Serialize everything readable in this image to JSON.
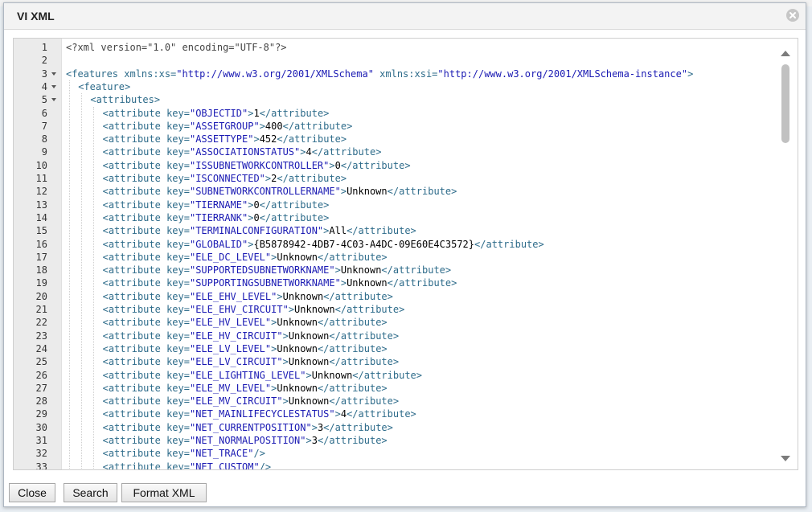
{
  "dialog": {
    "title": "VI XML"
  },
  "buttons": {
    "close": "Close",
    "search": "Search",
    "format_xml": "Format XML"
  },
  "editor": {
    "fold_lines": [
      3,
      4,
      5
    ],
    "lines": [
      {
        "n": "1",
        "indent": 0,
        "parts": [
          [
            "decl",
            "<?xml version=\"1.0\" encoding=\"UTF-8\"?>"
          ]
        ]
      },
      {
        "n": "2",
        "indent": 0,
        "parts": []
      },
      {
        "n": "3",
        "indent": 0,
        "parts": [
          [
            "tag",
            "<features "
          ],
          [
            "attr",
            "xmlns:xs="
          ],
          [
            "str",
            "\"http://www.w3.org/2001/XMLSchema\""
          ],
          [
            "attr",
            " xmlns:xsi="
          ],
          [
            "str",
            "\"http://www.w3.org/2001/XMLSchema-instance\""
          ],
          [
            "tag",
            ">"
          ]
        ]
      },
      {
        "n": "4",
        "indent": 1,
        "parts": [
          [
            "tag",
            "<feature>"
          ]
        ]
      },
      {
        "n": "5",
        "indent": 2,
        "parts": [
          [
            "tag",
            "<attributes>"
          ]
        ]
      },
      {
        "n": "6",
        "indent": 3,
        "parts": [
          [
            "tag",
            "<attribute "
          ],
          [
            "attr",
            "key="
          ],
          [
            "str",
            "\"OBJECTID\""
          ],
          [
            "tag",
            ">"
          ],
          [
            "text",
            "1"
          ],
          [
            "tag",
            "</attribute>"
          ]
        ]
      },
      {
        "n": "7",
        "indent": 3,
        "parts": [
          [
            "tag",
            "<attribute "
          ],
          [
            "attr",
            "key="
          ],
          [
            "str",
            "\"ASSETGROUP\""
          ],
          [
            "tag",
            ">"
          ],
          [
            "text",
            "400"
          ],
          [
            "tag",
            "</attribute>"
          ]
        ]
      },
      {
        "n": "8",
        "indent": 3,
        "parts": [
          [
            "tag",
            "<attribute "
          ],
          [
            "attr",
            "key="
          ],
          [
            "str",
            "\"ASSETTYPE\""
          ],
          [
            "tag",
            ">"
          ],
          [
            "text",
            "452"
          ],
          [
            "tag",
            "</attribute>"
          ]
        ]
      },
      {
        "n": "9",
        "indent": 3,
        "parts": [
          [
            "tag",
            "<attribute "
          ],
          [
            "attr",
            "key="
          ],
          [
            "str",
            "\"ASSOCIATIONSTATUS\""
          ],
          [
            "tag",
            ">"
          ],
          [
            "text",
            "4"
          ],
          [
            "tag",
            "</attribute>"
          ]
        ]
      },
      {
        "n": "10",
        "indent": 3,
        "parts": [
          [
            "tag",
            "<attribute "
          ],
          [
            "attr",
            "key="
          ],
          [
            "str",
            "\"ISSUBNETWORKCONTROLLER\""
          ],
          [
            "tag",
            ">"
          ],
          [
            "text",
            "0"
          ],
          [
            "tag",
            "</attribute>"
          ]
        ]
      },
      {
        "n": "11",
        "indent": 3,
        "parts": [
          [
            "tag",
            "<attribute "
          ],
          [
            "attr",
            "key="
          ],
          [
            "str",
            "\"ISCONNECTED\""
          ],
          [
            "tag",
            ">"
          ],
          [
            "text",
            "2"
          ],
          [
            "tag",
            "</attribute>"
          ]
        ]
      },
      {
        "n": "12",
        "indent": 3,
        "parts": [
          [
            "tag",
            "<attribute "
          ],
          [
            "attr",
            "key="
          ],
          [
            "str",
            "\"SUBNETWORKCONTROLLERNAME\""
          ],
          [
            "tag",
            ">"
          ],
          [
            "text",
            "Unknown"
          ],
          [
            "tag",
            "</attribute>"
          ]
        ]
      },
      {
        "n": "13",
        "indent": 3,
        "parts": [
          [
            "tag",
            "<attribute "
          ],
          [
            "attr",
            "key="
          ],
          [
            "str",
            "\"TIERNAME\""
          ],
          [
            "tag",
            ">"
          ],
          [
            "text",
            "0"
          ],
          [
            "tag",
            "</attribute>"
          ]
        ]
      },
      {
        "n": "14",
        "indent": 3,
        "parts": [
          [
            "tag",
            "<attribute "
          ],
          [
            "attr",
            "key="
          ],
          [
            "str",
            "\"TIERRANK\""
          ],
          [
            "tag",
            ">"
          ],
          [
            "text",
            "0"
          ],
          [
            "tag",
            "</attribute>"
          ]
        ]
      },
      {
        "n": "15",
        "indent": 3,
        "parts": [
          [
            "tag",
            "<attribute "
          ],
          [
            "attr",
            "key="
          ],
          [
            "str",
            "\"TERMINALCONFIGURATION\""
          ],
          [
            "tag",
            ">"
          ],
          [
            "text",
            "All"
          ],
          [
            "tag",
            "</attribute>"
          ]
        ]
      },
      {
        "n": "16",
        "indent": 3,
        "parts": [
          [
            "tag",
            "<attribute "
          ],
          [
            "attr",
            "key="
          ],
          [
            "str",
            "\"GLOBALID\""
          ],
          [
            "tag",
            ">"
          ],
          [
            "text",
            "{B5878942-4DB7-4C03-A4DC-09E60E4C3572}"
          ],
          [
            "tag",
            "</attribute>"
          ]
        ]
      },
      {
        "n": "17",
        "indent": 3,
        "parts": [
          [
            "tag",
            "<attribute "
          ],
          [
            "attr",
            "key="
          ],
          [
            "str",
            "\"ELE_DC_LEVEL\""
          ],
          [
            "tag",
            ">"
          ],
          [
            "text",
            "Unknown"
          ],
          [
            "tag",
            "</attribute>"
          ]
        ]
      },
      {
        "n": "18",
        "indent": 3,
        "parts": [
          [
            "tag",
            "<attribute "
          ],
          [
            "attr",
            "key="
          ],
          [
            "str",
            "\"SUPPORTEDSUBNETWORKNAME\""
          ],
          [
            "tag",
            ">"
          ],
          [
            "text",
            "Unknown"
          ],
          [
            "tag",
            "</attribute>"
          ]
        ]
      },
      {
        "n": "19",
        "indent": 3,
        "parts": [
          [
            "tag",
            "<attribute "
          ],
          [
            "attr",
            "key="
          ],
          [
            "str",
            "\"SUPPORTINGSUBNETWORKNAME\""
          ],
          [
            "tag",
            ">"
          ],
          [
            "text",
            "Unknown"
          ],
          [
            "tag",
            "</attribute>"
          ]
        ]
      },
      {
        "n": "20",
        "indent": 3,
        "parts": [
          [
            "tag",
            "<attribute "
          ],
          [
            "attr",
            "key="
          ],
          [
            "str",
            "\"ELE_EHV_LEVEL\""
          ],
          [
            "tag",
            ">"
          ],
          [
            "text",
            "Unknown"
          ],
          [
            "tag",
            "</attribute>"
          ]
        ]
      },
      {
        "n": "21",
        "indent": 3,
        "parts": [
          [
            "tag",
            "<attribute "
          ],
          [
            "attr",
            "key="
          ],
          [
            "str",
            "\"ELE_EHV_CIRCUIT\""
          ],
          [
            "tag",
            ">"
          ],
          [
            "text",
            "Unknown"
          ],
          [
            "tag",
            "</attribute>"
          ]
        ]
      },
      {
        "n": "22",
        "indent": 3,
        "parts": [
          [
            "tag",
            "<attribute "
          ],
          [
            "attr",
            "key="
          ],
          [
            "str",
            "\"ELE_HV_LEVEL\""
          ],
          [
            "tag",
            ">"
          ],
          [
            "text",
            "Unknown"
          ],
          [
            "tag",
            "</attribute>"
          ]
        ]
      },
      {
        "n": "23",
        "indent": 3,
        "parts": [
          [
            "tag",
            "<attribute "
          ],
          [
            "attr",
            "key="
          ],
          [
            "str",
            "\"ELE_HV_CIRCUIT\""
          ],
          [
            "tag",
            ">"
          ],
          [
            "text",
            "Unknown"
          ],
          [
            "tag",
            "</attribute>"
          ]
        ]
      },
      {
        "n": "24",
        "indent": 3,
        "parts": [
          [
            "tag",
            "<attribute "
          ],
          [
            "attr",
            "key="
          ],
          [
            "str",
            "\"ELE_LV_LEVEL\""
          ],
          [
            "tag",
            ">"
          ],
          [
            "text",
            "Unknown"
          ],
          [
            "tag",
            "</attribute>"
          ]
        ]
      },
      {
        "n": "25",
        "indent": 3,
        "parts": [
          [
            "tag",
            "<attribute "
          ],
          [
            "attr",
            "key="
          ],
          [
            "str",
            "\"ELE_LV_CIRCUIT\""
          ],
          [
            "tag",
            ">"
          ],
          [
            "text",
            "Unknown"
          ],
          [
            "tag",
            "</attribute>"
          ]
        ]
      },
      {
        "n": "26",
        "indent": 3,
        "parts": [
          [
            "tag",
            "<attribute "
          ],
          [
            "attr",
            "key="
          ],
          [
            "str",
            "\"ELE_LIGHTING_LEVEL\""
          ],
          [
            "tag",
            ">"
          ],
          [
            "text",
            "Unknown"
          ],
          [
            "tag",
            "</attribute>"
          ]
        ]
      },
      {
        "n": "27",
        "indent": 3,
        "parts": [
          [
            "tag",
            "<attribute "
          ],
          [
            "attr",
            "key="
          ],
          [
            "str",
            "\"ELE_MV_LEVEL\""
          ],
          [
            "tag",
            ">"
          ],
          [
            "text",
            "Unknown"
          ],
          [
            "tag",
            "</attribute>"
          ]
        ]
      },
      {
        "n": "28",
        "indent": 3,
        "parts": [
          [
            "tag",
            "<attribute "
          ],
          [
            "attr",
            "key="
          ],
          [
            "str",
            "\"ELE_MV_CIRCUIT\""
          ],
          [
            "tag",
            ">"
          ],
          [
            "text",
            "Unknown"
          ],
          [
            "tag",
            "</attribute>"
          ]
        ]
      },
      {
        "n": "29",
        "indent": 3,
        "parts": [
          [
            "tag",
            "<attribute "
          ],
          [
            "attr",
            "key="
          ],
          [
            "str",
            "\"NET_MAINLIFECYCLESTATUS\""
          ],
          [
            "tag",
            ">"
          ],
          [
            "text",
            "4"
          ],
          [
            "tag",
            "</attribute>"
          ]
        ]
      },
      {
        "n": "30",
        "indent": 3,
        "parts": [
          [
            "tag",
            "<attribute "
          ],
          [
            "attr",
            "key="
          ],
          [
            "str",
            "\"NET_CURRENTPOSITION\""
          ],
          [
            "tag",
            ">"
          ],
          [
            "text",
            "3"
          ],
          [
            "tag",
            "</attribute>"
          ]
        ]
      },
      {
        "n": "31",
        "indent": 3,
        "parts": [
          [
            "tag",
            "<attribute "
          ],
          [
            "attr",
            "key="
          ],
          [
            "str",
            "\"NET_NORMALPOSITION\""
          ],
          [
            "tag",
            ">"
          ],
          [
            "text",
            "3"
          ],
          [
            "tag",
            "</attribute>"
          ]
        ]
      },
      {
        "n": "32",
        "indent": 3,
        "parts": [
          [
            "tag",
            "<attribute "
          ],
          [
            "attr",
            "key="
          ],
          [
            "str",
            "\"NET_TRACE\""
          ],
          [
            "tag",
            "/>"
          ]
        ]
      },
      {
        "n": "33",
        "indent": 3,
        "parts": [
          [
            "tag",
            "<attribute "
          ],
          [
            "attr",
            "key="
          ],
          [
            "str",
            "\"NET_CUSTOM\""
          ],
          [
            "tag",
            "/>"
          ]
        ]
      }
    ]
  }
}
